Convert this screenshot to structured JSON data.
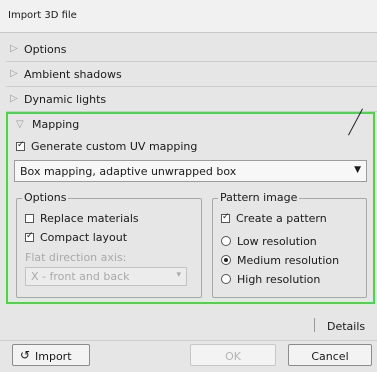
{
  "window": {
    "title": "Import 3D file"
  },
  "sections": {
    "options": {
      "label": "Options",
      "arrow": "▷"
    },
    "ambient_shadows": {
      "label": "Ambient shadows",
      "arrow": "▷"
    },
    "dynamic_lights": {
      "label": "Dynamic lights",
      "arrow": "▷"
    },
    "mapping": {
      "label": "Mapping",
      "arrow": "▽"
    }
  },
  "mapping": {
    "generate_uv": {
      "label": "Generate custom UV mapping",
      "checked": true
    },
    "mapping_type": {
      "value": "Box mapping, adaptive unwrapped box",
      "dropdown_glyph": "▼"
    },
    "options_group": {
      "title": "Options",
      "replace_materials": {
        "label": "Replace materials",
        "checked": false
      },
      "compact_layout": {
        "label": "Compact layout",
        "checked": true
      },
      "flat_direction_label": "Flat direction axis:",
      "flat_direction_value": "X - front and back",
      "flat_direction_glyph": "▾"
    },
    "pattern_group": {
      "title": "Pattern image",
      "create_pattern": {
        "label": "Create a pattern",
        "checked": true
      },
      "resolutions": [
        {
          "label": "Low resolution",
          "checked": false
        },
        {
          "label": "Medium resolution",
          "checked": true
        },
        {
          "label": "High resolution",
          "checked": false
        }
      ]
    }
  },
  "footer": {
    "details_label": "Details",
    "import_label": "Import",
    "import_icon": "↺",
    "ok_label": "OK",
    "cancel_label": "Cancel"
  },
  "colors": {
    "highlight_border": "#46d846"
  }
}
